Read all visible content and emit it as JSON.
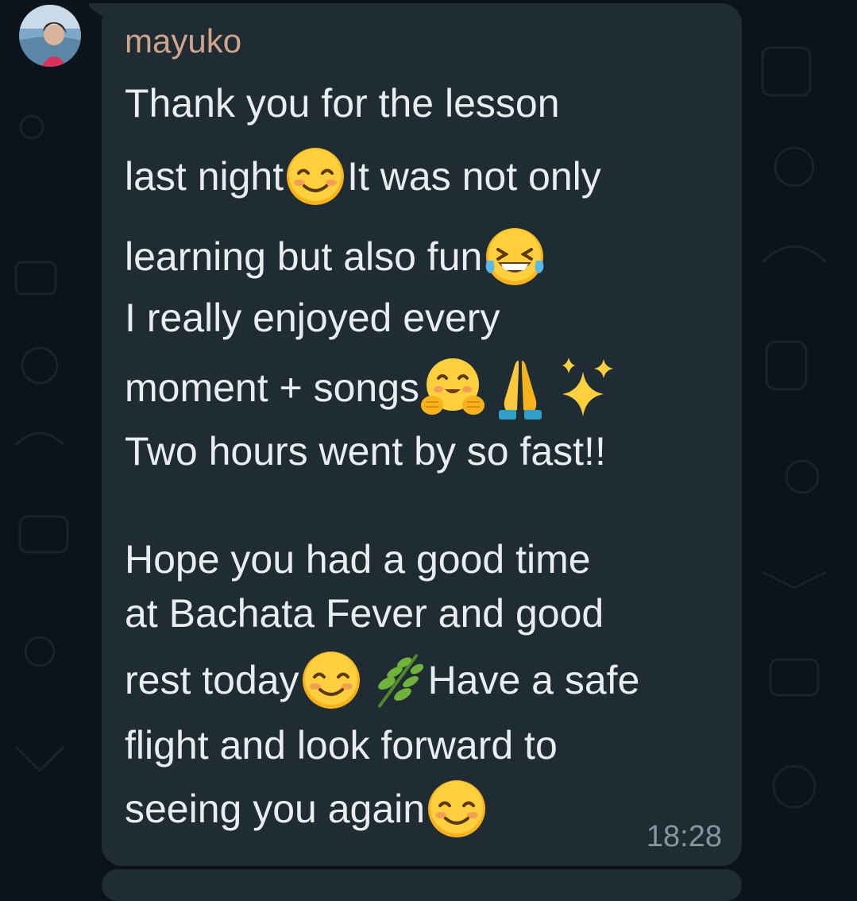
{
  "message": {
    "sender": "mayuko",
    "lines": [
      {
        "text": "Thank you for the lesson",
        "emojis_after": []
      },
      {
        "text": "last night",
        "emojis_after": [
          "smiling-face-emoji"
        ],
        "tail": "It was not only"
      },
      {
        "text": "learning but also fun",
        "emojis_after": [
          "tears-of-joy-emoji"
        ]
      },
      {
        "text": "I really enjoyed every",
        "emojis_after": []
      },
      {
        "text": "moment + songs",
        "emojis_after": [
          "hugging-face-emoji",
          "folded-hands-emoji",
          "sparkles-emoji"
        ]
      },
      {
        "text": "Two hours went by so fast!!",
        "emojis_after": []
      },
      {
        "text": "Hope you had a good time",
        "emojis_after": []
      },
      {
        "text": "at Bachata Fever and good",
        "emojis_after": []
      },
      {
        "text": "rest today",
        "emojis_after": [
          "smiling-face-emoji",
          "herb-emoji"
        ],
        "tail": "Have a safe"
      },
      {
        "text": "flight and look forward to",
        "emojis_after": []
      },
      {
        "text": "seeing you again",
        "emojis_after": [
          "smiling-face-emoji"
        ]
      }
    ],
    "time": "18:28"
  },
  "colors": {
    "background": "#0b141a",
    "bubble": "#1f2c34",
    "sender_name": "#d1a58c",
    "message_text": "#e9edef",
    "timestamp": "#8696a0"
  }
}
